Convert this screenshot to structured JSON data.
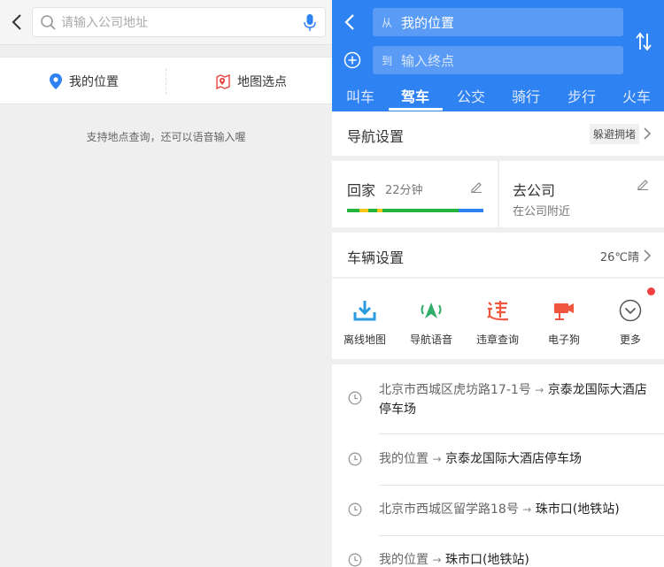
{
  "left": {
    "search": {
      "placeholder": "请输入公司地址"
    },
    "options": [
      {
        "label": "我的位置",
        "icon": "location-pin-icon"
      },
      {
        "label": "地图选点",
        "icon": "map-pick-icon"
      }
    ],
    "hint": "支持地点查询，还可以语音输入喔"
  },
  "right": {
    "from": {
      "prefix": "从",
      "value": "我的位置"
    },
    "to": {
      "prefix": "到",
      "placeholder": "输入终点"
    },
    "tabs": [
      {
        "label": "叫车"
      },
      {
        "label": "驾车",
        "active": true
      },
      {
        "label": "公交"
      },
      {
        "label": "骑行"
      },
      {
        "label": "步行"
      },
      {
        "label": "火车"
      }
    ],
    "nav_settings": {
      "title": "导航设置",
      "chip": "躲避拥堵"
    },
    "home": {
      "title": "回家",
      "time": "22分钟"
    },
    "work": {
      "title": "去公司",
      "subtitle": "在公司附近"
    },
    "vehicle": {
      "title": "车辆设置",
      "weather": "26℃晴"
    },
    "tools": [
      {
        "label": "离线地图",
        "icon": "download-icon"
      },
      {
        "label": "导航语音",
        "icon": "voice-nav-icon"
      },
      {
        "label": "违章查询",
        "icon": "violation-icon"
      },
      {
        "label": "电子狗",
        "icon": "camera-icon"
      },
      {
        "label": "更多",
        "icon": "chevron-circle-icon"
      }
    ],
    "history": [
      {
        "origin": "北京市西城区虎坊路17-1号",
        "dest": "京泰龙国际大酒店停车场"
      },
      {
        "origin": "我的位置",
        "dest": "京泰龙国际大酒店停车场"
      },
      {
        "origin": "北京市西城区留学路18号",
        "dest": "珠市口(地铁站)"
      },
      {
        "origin": "我的位置",
        "dest": "珠市口(地铁站)"
      }
    ],
    "arrow": "→"
  },
  "colors": {
    "accent": "#2f82f2",
    "traffic_green": "#24b33c",
    "badge_red": "#f04040"
  }
}
